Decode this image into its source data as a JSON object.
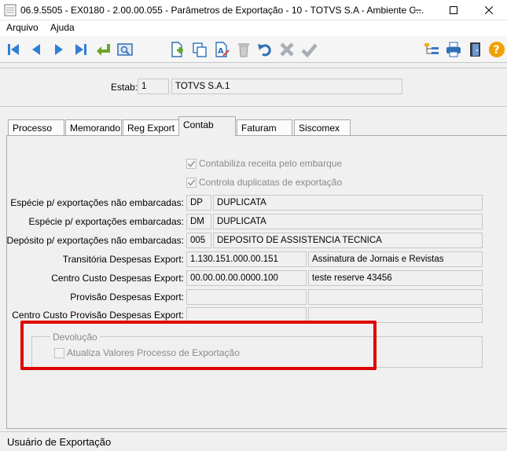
{
  "window": {
    "title": "06.9.5505 - EX0180 - 2.00.00.055 - Parâmetros de Exportação - 10 - TOTVS S.A - Ambiente C..."
  },
  "menu": {
    "items": [
      "Arquivo",
      "Ajuda"
    ]
  },
  "toolbar": {
    "nav": [
      "first-icon",
      "previous-icon",
      "next-icon",
      "last-icon",
      "goto-icon",
      "search-icon"
    ],
    "edit": [
      "new-icon",
      "copy-icon",
      "edit-icon",
      "delete-icon",
      "undo-icon",
      "cancel-icon",
      "ok-icon"
    ],
    "right": [
      "tree-icon",
      "print-icon",
      "exit-icon",
      "help-icon"
    ]
  },
  "header": {
    "estab_label": "Estab:",
    "estab_code": "1",
    "estab_name": "TOTVS S.A.1"
  },
  "tabs": [
    "Processo",
    "Memorando",
    "Reg Export",
    "Contab",
    "Faturam",
    "Siscomex"
  ],
  "active_tab": "Contab",
  "contab": {
    "checkbox1": "Contabiliza receita pelo embarque",
    "checkbox2": "Controla duplicatas de exportação",
    "rows": [
      {
        "label": "Espécie p/ exportações não embarcadas:",
        "code": "DP",
        "desc": "DUPLICATA"
      },
      {
        "label": "Espécie p/ exportações embarcadas:",
        "code": "DM",
        "desc": "DUPLICATA"
      },
      {
        "label": "Depósito p/ exportações não embarcadas:",
        "code": "005",
        "desc": "DEPOSITO DE ASSISTENCIA TECNICA"
      },
      {
        "label": "Transitória Despesas Export:",
        "code": "1.130.151.000.00.151",
        "desc": "Assinatura de Jornais e Revistas"
      },
      {
        "label": "Centro Custo Despesas Export:",
        "code": "00.00.00.00.0000.100",
        "desc": "teste reserve 43456"
      },
      {
        "label": "Provisão Despesas Export:",
        "code": "",
        "desc": ""
      },
      {
        "label": "Centro Custo Provisão Despesas Export:",
        "code": "",
        "desc": ""
      }
    ],
    "devolucao": {
      "legend": "Devolução",
      "checkbox": "Atualiza Valores Processo de Exportação"
    }
  },
  "status": {
    "text": "Usuário de Exportação"
  },
  "colors": {
    "highlight": "#e00000",
    "nav_blue": "#2f7fd6",
    "green": "#6aa52a"
  }
}
